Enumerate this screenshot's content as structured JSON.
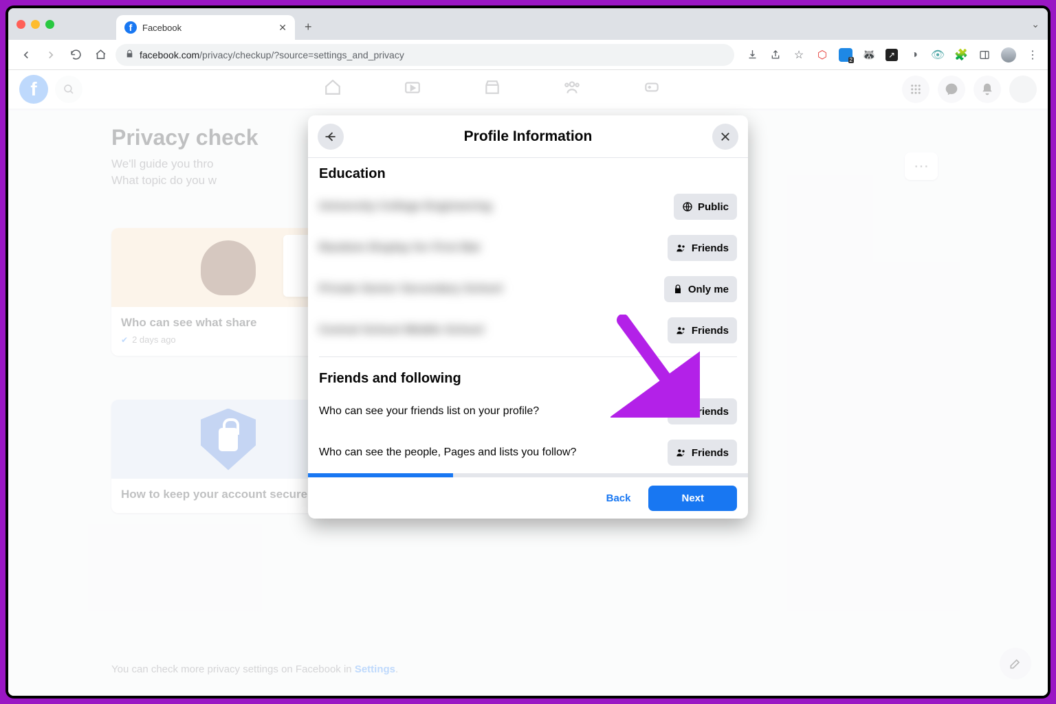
{
  "browser": {
    "tab_title": "Facebook",
    "url_host": "facebook.com",
    "url_path": "/privacy/checkup/?source=settings_and_privacy"
  },
  "background": {
    "heading": "Privacy check",
    "subtitle": "We'll guide you thro",
    "subtitle2": "What topic do you w",
    "card1_title": "Who can see what share",
    "card1_meta": "2 days ago",
    "card2_title": "How to keep your account secure",
    "footer_pre": "You can check more privacy settings on Facebook in ",
    "footer_link": "Settings"
  },
  "modal": {
    "title": "Profile Information",
    "section1_title": "Education",
    "section2_title": "Friends and following",
    "education": [
      {
        "label": "University College Engineering",
        "audience": "Public",
        "icon": "globe"
      },
      {
        "label": "Random Display for First Bat",
        "audience": "Friends",
        "icon": "friends"
      },
      {
        "label": "Private Senior Secondary School",
        "audience": "Only me",
        "icon": "lock"
      },
      {
        "label": "Central School Middle School",
        "audience": "Friends",
        "icon": "friends"
      }
    ],
    "following": [
      {
        "label": "Who can see your friends list on your profile?",
        "audience": "Friends",
        "icon": "friends"
      },
      {
        "label": "Who can see the people, Pages and lists you follow?",
        "audience": "Friends",
        "icon": "friends"
      }
    ],
    "back_label": "Back",
    "next_label": "Next"
  }
}
